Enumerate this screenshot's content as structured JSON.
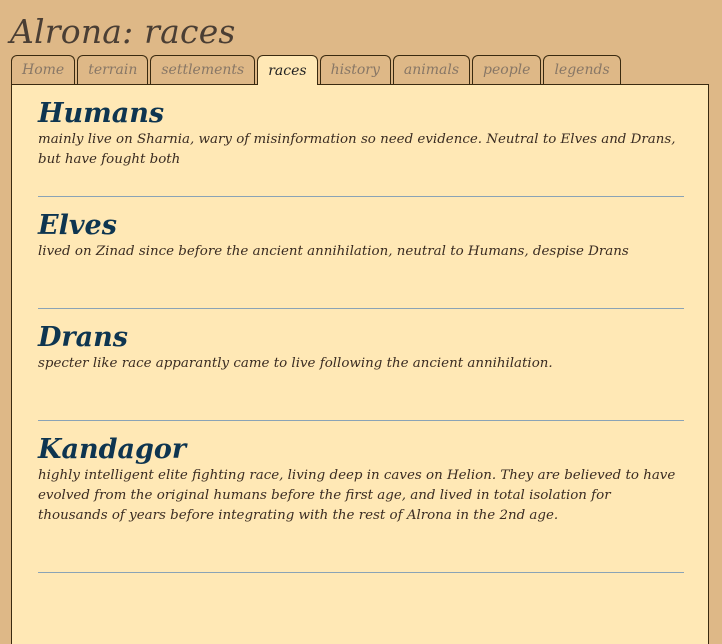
{
  "site_title": "Alrona: races",
  "tabs": [
    {
      "label": "Home",
      "active": false
    },
    {
      "label": "terrain",
      "active": false
    },
    {
      "label": "settlements",
      "active": false
    },
    {
      "label": "races",
      "active": true
    },
    {
      "label": "history",
      "active": false
    },
    {
      "label": "animals",
      "active": false
    },
    {
      "label": "people",
      "active": false
    },
    {
      "label": "legends",
      "active": false
    }
  ],
  "races": [
    {
      "name": "Humans",
      "description": "mainly live on Sharnia, wary of misinformation so need evidence. Neutral to Elves and Drans, but have fought both"
    },
    {
      "name": "Elves",
      "description": "lived on Zinad since before the ancient annihilation, neutral to Humans, despise Drans"
    },
    {
      "name": "Drans",
      "description": "specter like race apparantly came to live following the ancient annihilation."
    },
    {
      "name": "Kandagor",
      "description": "highly intelligent elite fighting race, living deep in caves on Helion. They are believed to have evolved from the original humans before the first age, and lived in total isolation for thousands of years before integrating with the rest of Alrona in the 2nd age."
    }
  ],
  "colors": {
    "page_background": "#deb887",
    "panel_background": "#ffe8b5",
    "heading": "#0e3550",
    "divider": "#8aa3b6"
  }
}
